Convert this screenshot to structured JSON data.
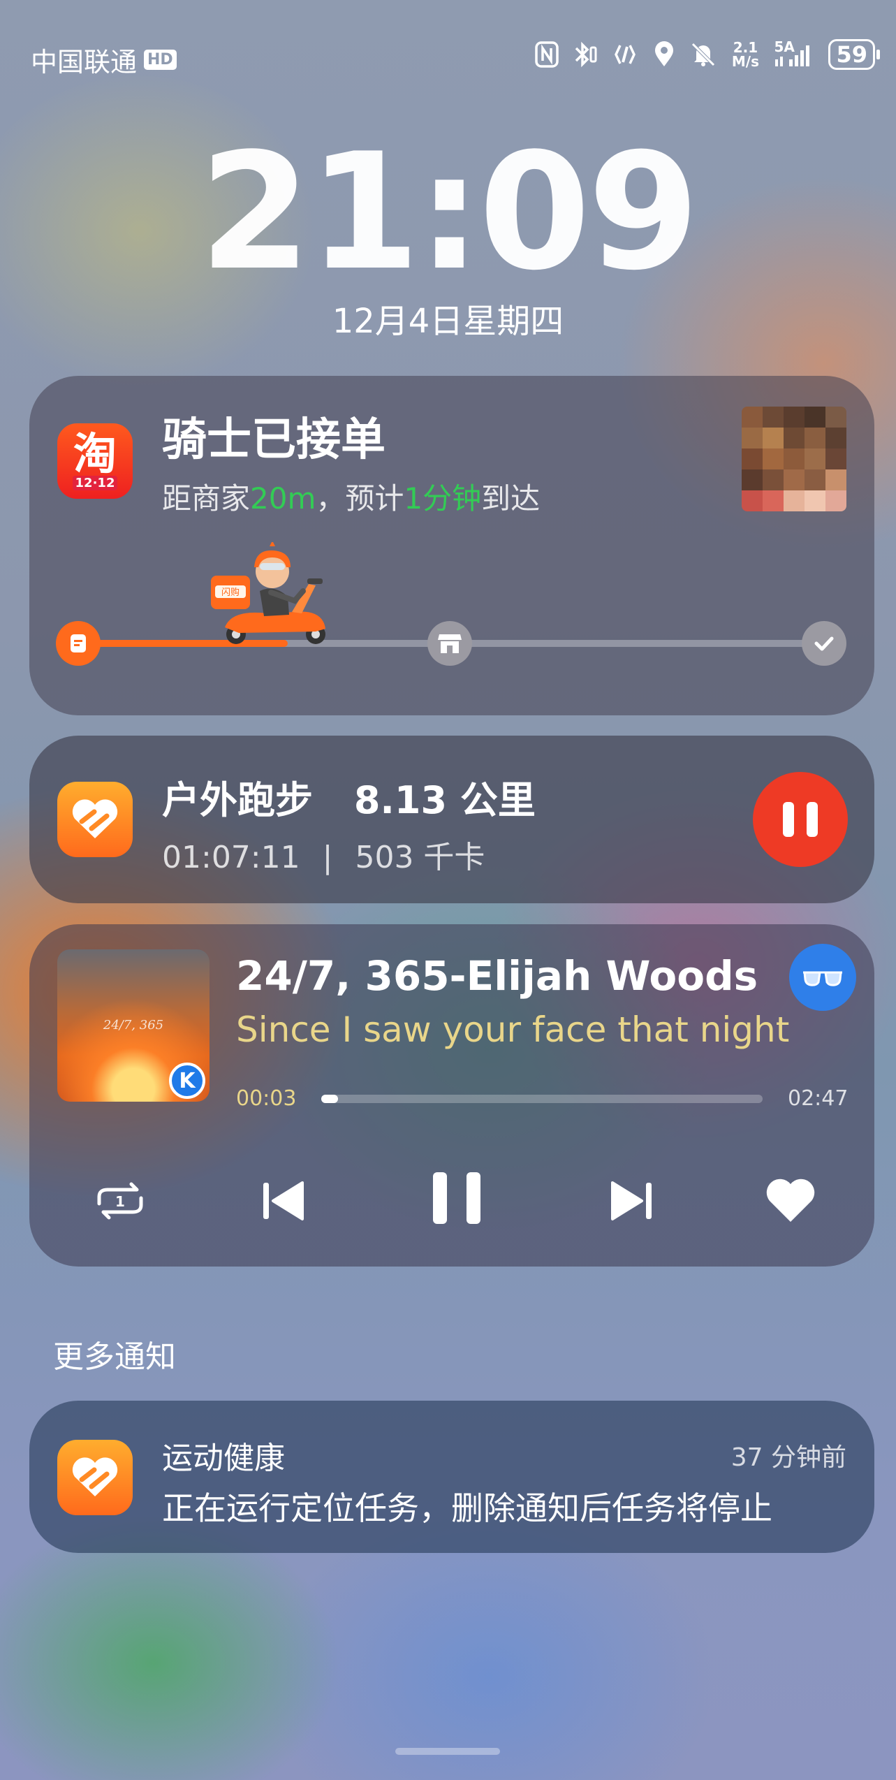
{
  "status_bar": {
    "carrier": "中国联通",
    "hd": "HD",
    "network_speed_value": "2.1",
    "network_speed_unit": "M/s",
    "signal_label_top": "5A",
    "battery": "59",
    "icons": [
      "nfc-icon",
      "bluetooth-icon",
      "vibrate-icon",
      "location-icon",
      "mute-icon",
      "signal-icon",
      "battery-icon"
    ]
  },
  "lock": {
    "time": "21:09",
    "date": "12月4日星期四"
  },
  "delivery_card": {
    "app_icon_text": "淘",
    "app_icon_badge": "12·12",
    "title": "骑士已接单",
    "sub_prefix": "距商家",
    "distance": "20m",
    "sub_mid": "，预计",
    "eta": "1分钟",
    "sub_suffix": "到达",
    "progress": 0.28,
    "scooter_box_label": "闪购",
    "accent": "#ff6a1c"
  },
  "workout_card": {
    "title": "户外跑步",
    "distance": "8.13 公里",
    "duration": "01:07:11",
    "separator": "|",
    "calories": "503 千卡",
    "pause_color": "#ee3a25"
  },
  "music_card": {
    "album_text": "24/7, 365",
    "service_badge": "K",
    "song": "24/7, 365-Elijah Woods",
    "lyric": "Since I saw your face that night",
    "elapsed": "00:03",
    "total": "02:47",
    "progress": 0.02,
    "repeat_count": "1"
  },
  "more": {
    "label": "更多通知"
  },
  "health_notification": {
    "app": "运动健康",
    "time": "37 分钟前",
    "body": "正在运行定位任务，删除通知后任务将停止"
  }
}
